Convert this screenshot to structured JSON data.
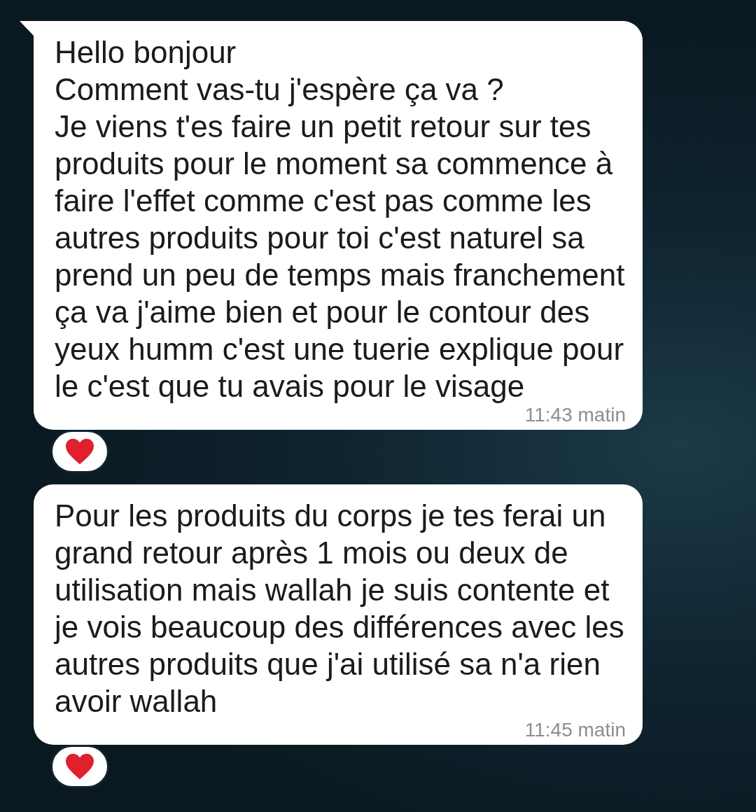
{
  "messages": [
    {
      "text": "Hello bonjour\nComment vas-tu j'espère ça va ?\nJe viens t'es faire un petit retour sur tes produits pour le moment sa commence à faire l'effet comme c'est pas comme les autres produits pour toi c'est naturel sa prend un peu de temps mais franchement ça va j'aime bien et pour le contour des yeux humm c'est une tuerie explique pour le c'est que tu avais pour le visage",
      "time": "11:43 matin",
      "tail": true
    },
    {
      "text": "Pour les produits du corps je tes ferai un grand retour après 1 mois ou deux de utilisation mais wallah je suis contente et je vois beaucoup des différences avec les autres produits que j'ai utilisé sa n'a rien avoir wallah",
      "time": "11:45 matin",
      "tail": false
    }
  ]
}
